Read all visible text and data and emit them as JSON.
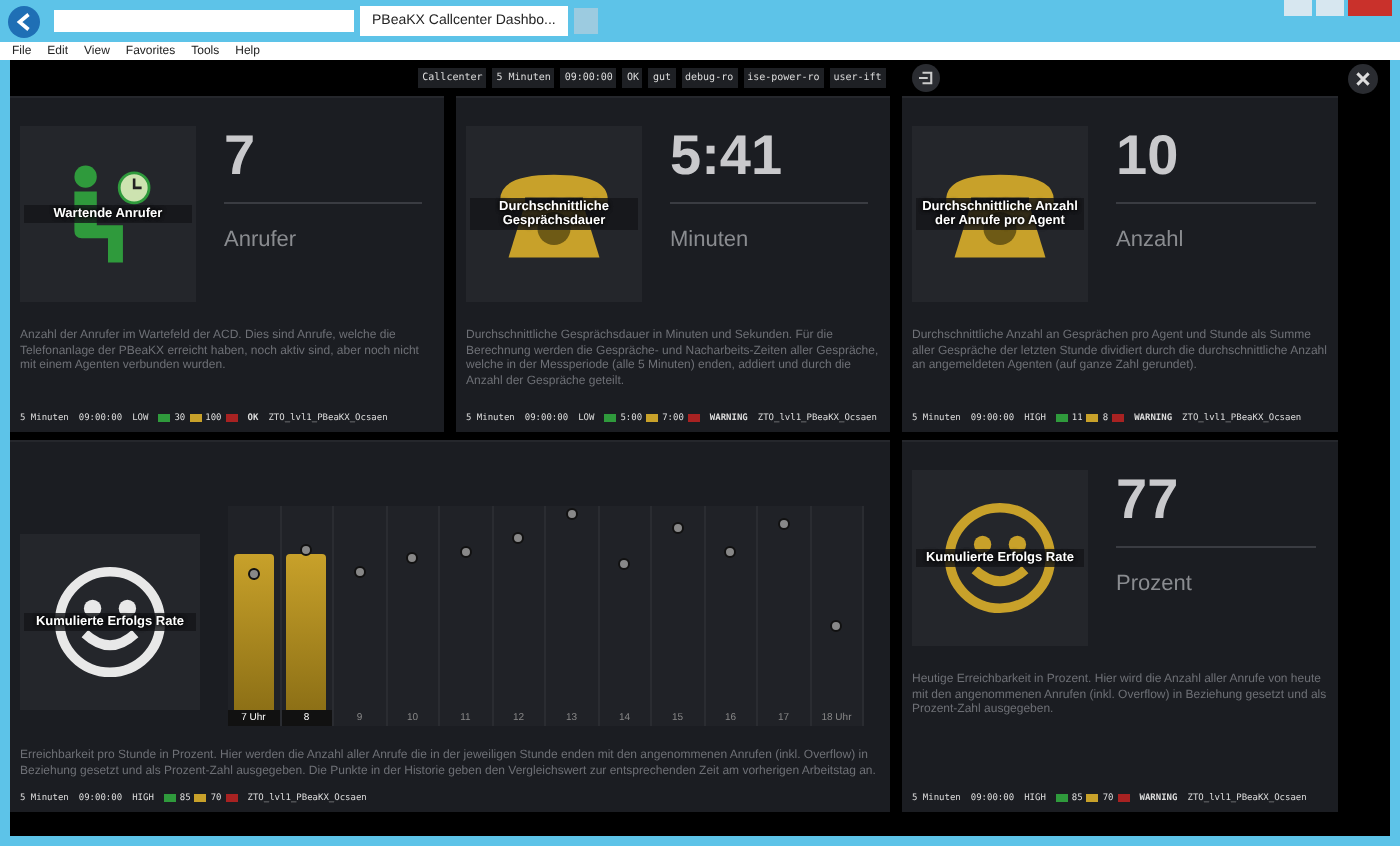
{
  "browser": {
    "tab_title": "PBeaKX Callcenter Dashbo...",
    "menu": [
      "File",
      "Edit",
      "View",
      "Favorites",
      "Tools",
      "Help"
    ]
  },
  "toolbar": {
    "chips": [
      "Callcenter",
      "5 Minuten",
      "09:00:00",
      "OK",
      "gut",
      "debug-ro",
      "ise-power-ro",
      "user-ift"
    ]
  },
  "panels": [
    {
      "kind": "stat",
      "tile_label": "Wartende Anrufer",
      "value": "7",
      "unit": "Anrufer",
      "description": "Anzahl der Anrufer im Wartefeld der ACD. Dies sind Anrufe, welche die Telefonanlage der PBeaKX erreicht haben, noch aktiv sind, aber noch nicht mit einem Agenten verbunden wurden.",
      "footer": {
        "interval": "5 Minuten",
        "time": "09:00:00",
        "direction": "LOW",
        "scale": [
          {
            "color": "#2f9a3c",
            "label": "30"
          },
          {
            "color": "#c8a12a",
            "label": "100"
          },
          {
            "color": "#a82222"
          }
        ],
        "status": "OK",
        "source": "ZTO_lvl1_PBeaKX_Ocsaen"
      }
    },
    {
      "kind": "stat",
      "tile_label": "Durchschnittliche Gesprächsdauer",
      "value": "5:41",
      "unit": "Minuten",
      "description": "Durchschnittliche Gesprächsdauer in Minuten und Sekunden. Für die Berechnung werden die Gespräche- und Nacharbeits-Zeiten aller Gespräche, welche in der Messperiode (alle 5 Minuten) enden, addiert und durch die Anzahl der Gespräche geteilt.",
      "footer": {
        "interval": "5 Minuten",
        "time": "09:00:00",
        "direction": "LOW",
        "scale": [
          {
            "color": "#2f9a3c",
            "label": "5:00"
          },
          {
            "color": "#c8a12a",
            "label": "7:00"
          },
          {
            "color": "#a82222"
          }
        ],
        "status": "WARNING",
        "source": "ZTO_lvl1_PBeaKX_Ocsaen"
      }
    },
    {
      "kind": "stat",
      "tile_label": "Durchschnittliche Anzahl der Anrufe pro Agent",
      "value": "10",
      "unit": "Anzahl",
      "description": "Durchschnittliche Anzahl an Gesprächen pro Agent und Stunde als Summe aller Gespräche der letzten Stunde dividiert durch die durchschnittliche Anzahl an angemeldeten Agenten (auf ganze Zahl gerundet).",
      "footer": {
        "interval": "5 Minuten",
        "time": "09:00:00",
        "direction": "HIGH",
        "scale": [
          {
            "color": "#2f9a3c",
            "label": "11"
          },
          {
            "color": "#c8a12a",
            "label": "8"
          },
          {
            "color": "#a82222"
          }
        ],
        "status": "WARNING",
        "source": "ZTO_lvl1_PBeaKX_Ocsaen"
      }
    },
    {
      "kind": "history",
      "tile_label": "Kumulierte Erfolgs Rate",
      "hours": [
        {
          "label": "7 Uhr",
          "kind": "bar"
        },
        {
          "label": "8",
          "kind": "bar"
        },
        {
          "label": "9",
          "kind": "dot"
        },
        {
          "label": "10",
          "kind": "dot"
        },
        {
          "label": "11",
          "kind": "dot"
        },
        {
          "label": "12",
          "kind": "dot"
        },
        {
          "label": "13",
          "kind": "dot"
        },
        {
          "label": "14",
          "kind": "dot"
        },
        {
          "label": "15",
          "kind": "dot"
        },
        {
          "label": "16",
          "kind": "dot"
        },
        {
          "label": "17",
          "kind": "dot"
        },
        {
          "label": "18 Uhr",
          "kind": "dot"
        }
      ],
      "description": "Erreichbarkeit pro Stunde in Prozent. Hier werden die Anzahl aller Anrufe die in der jeweiligen Stunde enden mit den angenommenen Anrufen (inkl. Overflow) in Beziehung gesetzt und als Prozent-Zahl ausgegeben. Die Punkte in der Historie geben den Vergleichswert zur entsprechenden Zeit am vorherigen Arbeitstag an.",
      "footer": {
        "interval": "5 Minuten",
        "time": "09:00:00",
        "direction": "HIGH",
        "scale": [
          {
            "color": "#2f9a3c",
            "label": "85"
          },
          {
            "color": "#c8a12a",
            "label": "70"
          },
          {
            "color": "#a82222"
          }
        ],
        "source": "ZTO_lvl1_PBeaKX_Ocsaen"
      }
    },
    {
      "kind": "stat",
      "tile_label": "Kumulierte Erfolgs Rate",
      "value": "77",
      "unit": "Prozent",
      "description": "Heutige Erreichbarkeit in Prozent. Hier wird die Anzahl aller Anrufe von heute mit den angenommenen Anrufen (inkl. Overflow) in Beziehung gesetzt und als Prozent-Zahl ausgegeben.",
      "footer": {
        "interval": "5 Minuten",
        "time": "09:00:00",
        "direction": "HIGH",
        "scale": [
          {
            "color": "#2f9a3c",
            "label": "85"
          },
          {
            "color": "#c8a12a",
            "label": "70"
          },
          {
            "color": "#a82222"
          }
        ],
        "status": "WARNING",
        "source": "ZTO_lvl1_PBeaKX_Ocsaen"
      }
    }
  ]
}
